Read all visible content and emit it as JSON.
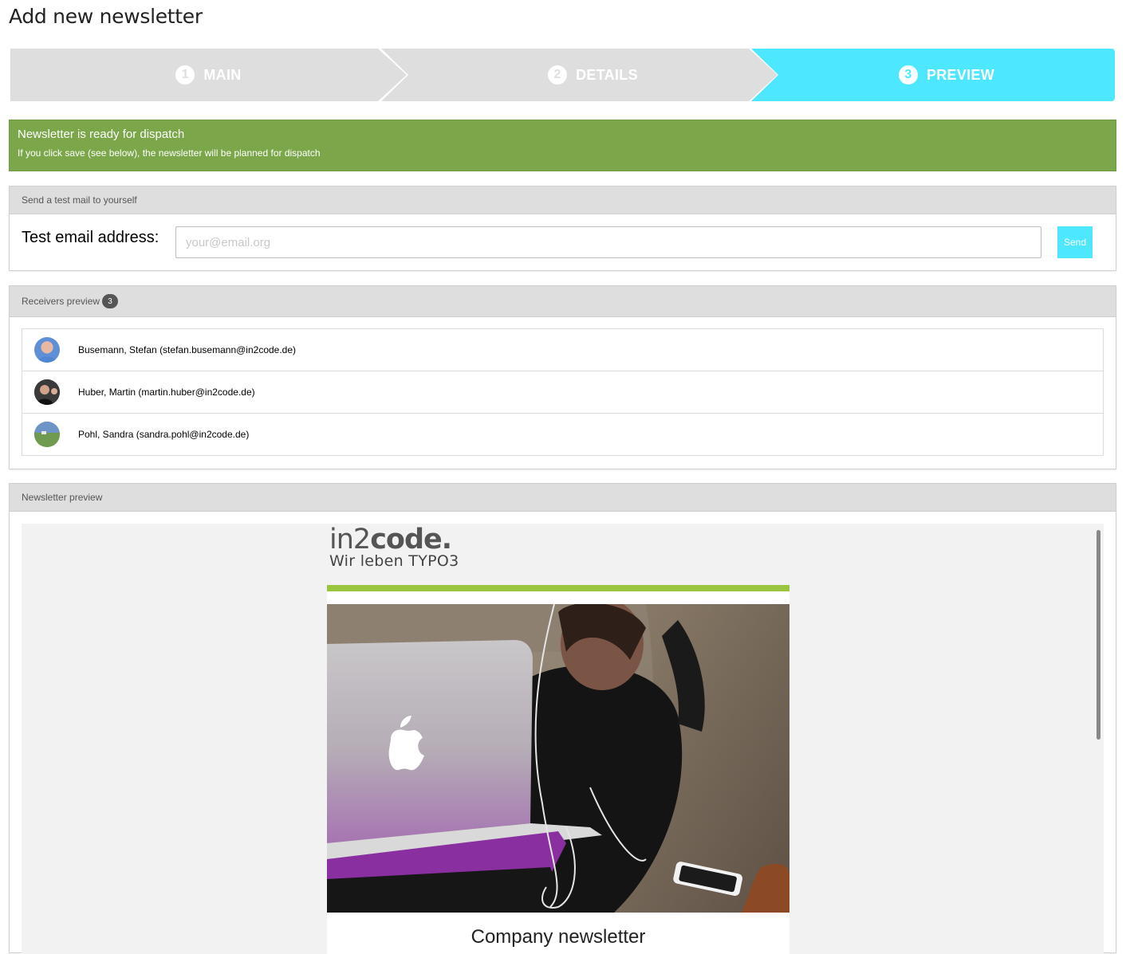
{
  "page": {
    "title": "Add new newsletter"
  },
  "wizard": {
    "steps": [
      {
        "number": "1",
        "label": "MAIN"
      },
      {
        "number": "2",
        "label": "DETAILS"
      },
      {
        "number": "3",
        "label": "PREVIEW"
      }
    ],
    "active_step": "3",
    "active_color": "#4de8ff",
    "inactive_color": "#dedede"
  },
  "alert": {
    "title": "Newsletter is ready for dispatch",
    "text": "If you click save (see below), the newsletter will be planned for dispatch",
    "color": "#7ba74a"
  },
  "test_mail": {
    "heading": "Send a test mail to yourself",
    "label": "Test email address:",
    "placeholder": "your@email.org",
    "value": "",
    "send_label": "Send"
  },
  "receivers": {
    "heading": "Receivers preview",
    "count": "3",
    "items": [
      {
        "text": "Busemann, Stefan (stefan.busemann@in2code.de)",
        "avatar": "avatar-photo"
      },
      {
        "text": "Huber, Martin (martin.huber@in2code.de)",
        "avatar": "avatar-photo"
      },
      {
        "text": "Pohl, Sandra (sandra.pohl@in2code.de)",
        "avatar": "avatar-photo"
      }
    ]
  },
  "newsletter_preview": {
    "heading": "Newsletter preview",
    "logo_light": "in2",
    "logo_bold": "code.",
    "logo_tagline": "Wir leben TYPO3",
    "accent_bar_color": "#9ac53f",
    "image": "laptop-photo",
    "content_heading": "Company newsletter"
  }
}
